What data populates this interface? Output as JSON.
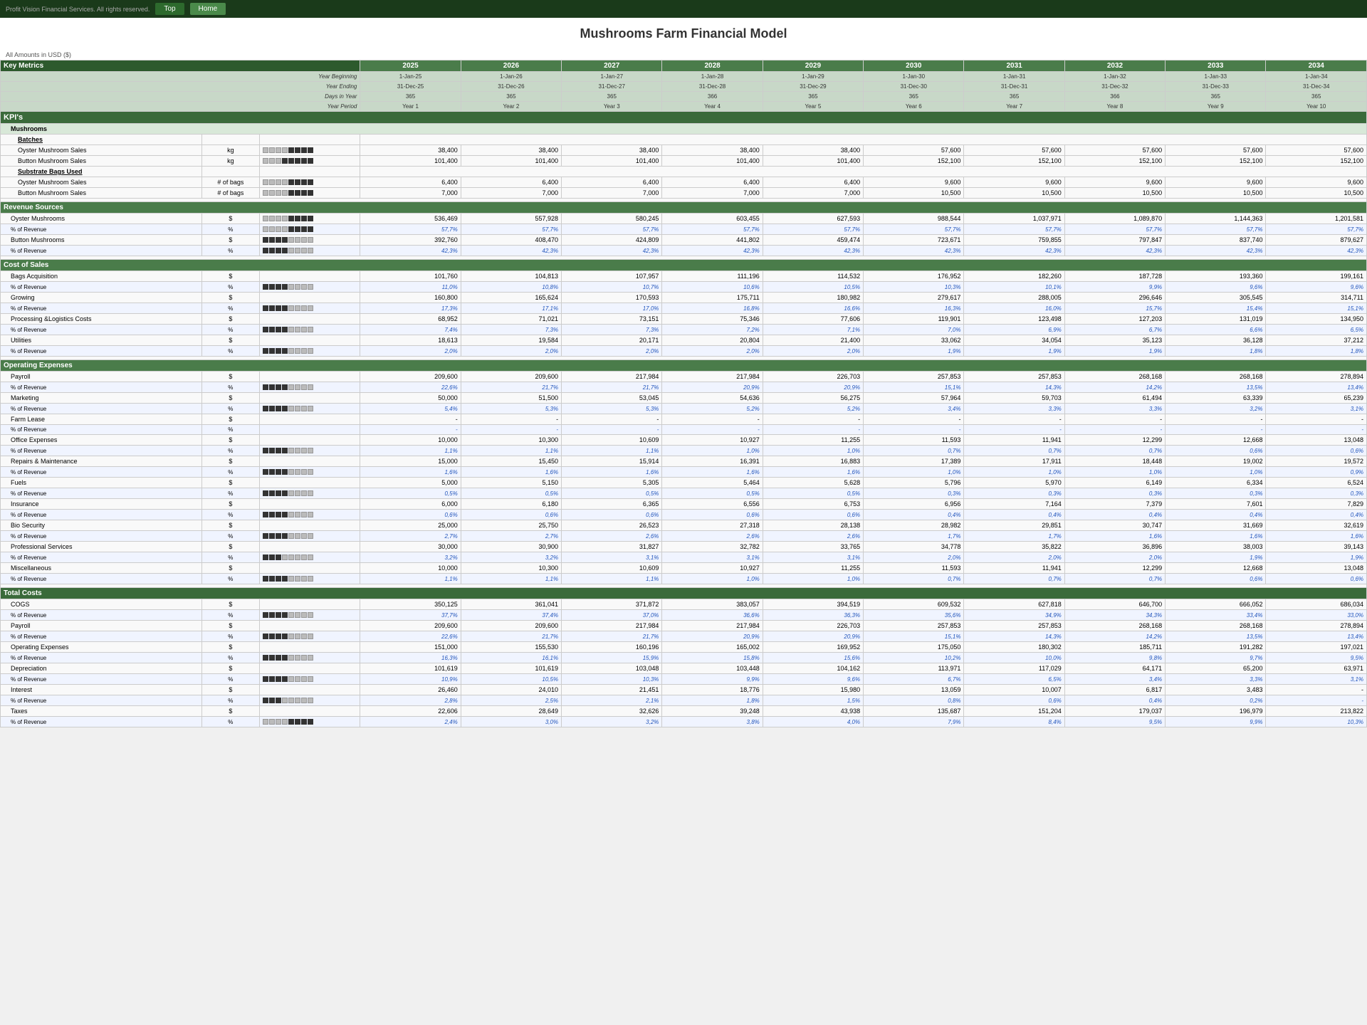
{
  "app": {
    "brand": "Profit Vision Financial Services. All rights reserved.",
    "title": "Mushrooms Farm Financial Model",
    "amounts_label": "All Amounts in USD ($)",
    "buttons": {
      "top": "Top",
      "home": "Home"
    }
  },
  "header": {
    "key_metrics": "Key Metrics",
    "years": [
      "2025",
      "2026",
      "2027",
      "2028",
      "2029",
      "2030",
      "2031",
      "2032",
      "2033",
      "2034"
    ],
    "year_beginning": [
      "1-Jan-25",
      "1-Jan-26",
      "1-Jan-27",
      "1-Jan-28",
      "1-Jan-29",
      "1-Jan-30",
      "1-Jan-31",
      "1-Jan-32",
      "1-Jan-33",
      "1-Jan-34"
    ],
    "year_ending": [
      "31-Dec-25",
      "31-Dec-26",
      "31-Dec-27",
      "31-Dec-28",
      "31-Dec-29",
      "31-Dec-30",
      "31-Dec-31",
      "31-Dec-32",
      "31-Dec-33",
      "31-Dec-34"
    ],
    "days_in_year": [
      "365",
      "365",
      "365",
      "366",
      "365",
      "365",
      "365",
      "366",
      "365",
      "365"
    ],
    "year_period": [
      "Year 1",
      "Year 2",
      "Year 3",
      "Year 4",
      "Year 5",
      "Year 6",
      "Year 7",
      "Year 8",
      "Year 9",
      "Year 10"
    ]
  },
  "sections": {
    "kpis": "KPI's",
    "mushrooms": "Mushrooms",
    "batches": "Batches",
    "substrate_bags_used": "Substrate Bags Used",
    "revenue_sources": "Revenue Sources",
    "cost_of_sales": "Cost of Sales",
    "operating_expenses": "Operating Expenses",
    "total_costs": "Total Costs"
  },
  "rows": {
    "oyster_mushroom_sales_kg": {
      "label": "Oyster Mushroom Sales",
      "unit": "kg",
      "vals": [
        "38,400",
        "38,400",
        "38,400",
        "38,400",
        "38,400",
        "57,600",
        "57,600",
        "57,600",
        "57,600",
        "57,600"
      ]
    },
    "button_mushroom_sales_kg": {
      "label": "Button Mushroom Sales",
      "unit": "kg",
      "vals": [
        "101,400",
        "101,400",
        "101,400",
        "101,400",
        "101,400",
        "152,100",
        "152,100",
        "152,100",
        "152,100",
        "152,100"
      ]
    },
    "oyster_bags": {
      "label": "Oyster Mushroom Sales",
      "unit": "# of bags",
      "vals": [
        "6,400",
        "6,400",
        "6,400",
        "6,400",
        "6,400",
        "9,600",
        "9,600",
        "9,600",
        "9,600",
        "9,600"
      ]
    },
    "button_bags": {
      "label": "Button Mushroom Sales",
      "unit": "# of bags",
      "vals": [
        "7,000",
        "7,000",
        "7,000",
        "7,000",
        "7,000",
        "10,500",
        "10,500",
        "10,500",
        "10,500",
        "10,500"
      ]
    },
    "oyster_revenue": {
      "label": "Oyster Mushrooms",
      "unit": "$",
      "vals": [
        "536,469",
        "557,928",
        "580,245",
        "603,455",
        "627,593",
        "988,544",
        "1,037,971",
        "1,089,870",
        "1,144,363",
        "1,201,581"
      ]
    },
    "oyster_pct": {
      "label": "% of Revenue",
      "unit": "%",
      "vals": [
        "57,7%",
        "57,7%",
        "57,7%",
        "57,7%",
        "57,7%",
        "57,7%",
        "57,7%",
        "57,7%",
        "57,7%",
        "57,7%"
      ]
    },
    "button_revenue": {
      "label": "Button Mushrooms",
      "unit": "$",
      "vals": [
        "392,760",
        "408,470",
        "424,809",
        "441,802",
        "459,474",
        "723,671",
        "759,855",
        "797,847",
        "837,740",
        "879,627"
      ]
    },
    "button_pct": {
      "label": "% of Revenue",
      "unit": "%",
      "vals": [
        "42,3%",
        "42,3%",
        "42,3%",
        "42,3%",
        "42,3%",
        "42,3%",
        "42,3%",
        "42,3%",
        "42,3%",
        "42,3%"
      ]
    },
    "bags_acq": {
      "label": "Bags Acquisition",
      "unit": "$",
      "vals": [
        "101,760",
        "104,813",
        "107,957",
        "111,196",
        "114,532",
        "176,952",
        "182,260",
        "187,728",
        "193,360",
        "199,161"
      ]
    },
    "bags_acq_pct": {
      "label": "% of Revenue",
      "unit": "%",
      "vals": [
        "11,0%",
        "10,8%",
        "10,7%",
        "10,6%",
        "10,5%",
        "10,3%",
        "10,1%",
        "9,9%",
        "9,6%",
        "9,6%"
      ]
    },
    "growing": {
      "label": "Growing",
      "unit": "$",
      "vals": [
        "160,800",
        "165,624",
        "170,593",
        "175,711",
        "180,982",
        "279,617",
        "288,005",
        "296,646",
        "305,545",
        "314,711"
      ]
    },
    "growing_pct": {
      "label": "% of Revenue",
      "unit": "%",
      "vals": [
        "17,3%",
        "17,1%",
        "17,0%",
        "16,8%",
        "16,6%",
        "16,3%",
        "16,0%",
        "15,7%",
        "15,4%",
        "15,1%"
      ]
    },
    "processing": {
      "label": "Processing &Logistics Costs",
      "unit": "$",
      "vals": [
        "68,952",
        "71,021",
        "73,151",
        "75,346",
        "77,606",
        "119,901",
        "123,498",
        "127,203",
        "131,019",
        "134,950"
      ]
    },
    "processing_pct": {
      "label": "% of Revenue",
      "unit": "%",
      "vals": [
        "7,4%",
        "7,3%",
        "7,3%",
        "7,2%",
        "7,1%",
        "7,0%",
        "6,9%",
        "6,7%",
        "6,6%",
        "6,5%"
      ]
    },
    "utilities": {
      "label": "Utilities",
      "unit": "$",
      "vals": [
        "18,613",
        "19,584",
        "20,171",
        "20,804",
        "21,400",
        "33,062",
        "34,054",
        "35,123",
        "36,128",
        "37,212"
      ]
    },
    "utilities_pct": {
      "label": "% of Revenue",
      "unit": "%",
      "vals": [
        "2,0%",
        "2,0%",
        "2,0%",
        "2,0%",
        "2,0%",
        "1,9%",
        "1,9%",
        "1,9%",
        "1,8%",
        "1,8%"
      ]
    },
    "payroll": {
      "label": "Payroll",
      "unit": "$",
      "vals": [
        "209,600",
        "209,600",
        "217,984",
        "217,984",
        "226,703",
        "257,853",
        "257,853",
        "268,168",
        "268,168",
        "278,894"
      ]
    },
    "payroll_pct": {
      "label": "% of Revenue",
      "unit": "%",
      "vals": [
        "22,6%",
        "21,7%",
        "21,7%",
        "20,9%",
        "20,9%",
        "15,1%",
        "14,3%",
        "14,2%",
        "13,5%",
        "13,4%"
      ]
    },
    "marketing": {
      "label": "Marketing",
      "unit": "$",
      "vals": [
        "50,000",
        "51,500",
        "53,045",
        "54,636",
        "56,275",
        "57,964",
        "59,703",
        "61,494",
        "63,339",
        "65,239"
      ]
    },
    "marketing_pct": {
      "label": "% of Revenue",
      "unit": "%",
      "vals": [
        "5,4%",
        "5,3%",
        "5,3%",
        "5,2%",
        "5,2%",
        "3,4%",
        "3,3%",
        "3,3%",
        "3,2%",
        "3,1%"
      ]
    },
    "farm_lease": {
      "label": "Farm Lease",
      "unit": "$",
      "vals": [
        "-",
        "-",
        "-",
        "-",
        "-",
        "-",
        "-",
        "-",
        "-",
        "-"
      ]
    },
    "farm_lease_pct": {
      "label": "% of Revenue",
      "unit": "%",
      "vals": [
        "-",
        "-",
        "-",
        "-",
        "-",
        "-",
        "-",
        "-",
        "-",
        "-"
      ]
    },
    "office_expenses": {
      "label": "Office Expenses",
      "unit": "$",
      "vals": [
        "10,000",
        "10,300",
        "10,609",
        "10,927",
        "11,255",
        "11,593",
        "11,941",
        "12,299",
        "12,668",
        "13,048"
      ]
    },
    "office_expenses_pct": {
      "label": "% of Revenue",
      "unit": "%",
      "vals": [
        "1,1%",
        "1,1%",
        "1,1%",
        "1,0%",
        "1,0%",
        "0,7%",
        "0,7%",
        "0,7%",
        "0,6%",
        "0,6%"
      ]
    },
    "repairs": {
      "label": "Repairs & Maintenance",
      "unit": "$",
      "vals": [
        "15,000",
        "15,450",
        "15,914",
        "16,391",
        "16,883",
        "17,389",
        "17,911",
        "18,448",
        "19,002",
        "19,572"
      ]
    },
    "repairs_pct": {
      "label": "% of Revenue",
      "unit": "%",
      "vals": [
        "1,6%",
        "1,6%",
        "1,6%",
        "1,6%",
        "1,6%",
        "1,0%",
        "1,0%",
        "1,0%",
        "1,0%",
        "0,9%"
      ]
    },
    "fuels": {
      "label": "Fuels",
      "unit": "$",
      "vals": [
        "5,000",
        "5,150",
        "5,305",
        "5,464",
        "5,628",
        "5,796",
        "5,970",
        "6,149",
        "6,334",
        "6,524"
      ]
    },
    "fuels_pct": {
      "label": "% of Revenue",
      "unit": "%",
      "vals": [
        "0,5%",
        "0,5%",
        "0,5%",
        "0,5%",
        "0,5%",
        "0,3%",
        "0,3%",
        "0,3%",
        "0,3%",
        "0,3%"
      ]
    },
    "insurance": {
      "label": "Insurance",
      "unit": "$",
      "vals": [
        "6,000",
        "6,180",
        "6,365",
        "6,556",
        "6,753",
        "6,956",
        "7,164",
        "7,379",
        "7,601",
        "7,829"
      ]
    },
    "insurance_pct": {
      "label": "% of Revenue",
      "unit": "%",
      "vals": [
        "0,6%",
        "0,6%",
        "0,6%",
        "0,6%",
        "0,6%",
        "0,4%",
        "0,4%",
        "0,4%",
        "0,4%",
        "0,4%"
      ]
    },
    "bio_security": {
      "label": "Bio Security",
      "unit": "$",
      "vals": [
        "25,000",
        "25,750",
        "26,523",
        "27,318",
        "28,138",
        "28,982",
        "29,851",
        "30,747",
        "31,669",
        "32,619"
      ]
    },
    "bio_security_pct": {
      "label": "% of Revenue",
      "unit": "%",
      "vals": [
        "2,7%",
        "2,7%",
        "2,6%",
        "2,6%",
        "2,6%",
        "1,7%",
        "1,7%",
        "1,6%",
        "1,6%",
        "1,6%"
      ]
    },
    "prof_services": {
      "label": "Professional Services",
      "unit": "$",
      "vals": [
        "30,000",
        "30,900",
        "31,827",
        "32,782",
        "33,765",
        "34,778",
        "35,822",
        "36,896",
        "38,003",
        "39,143"
      ]
    },
    "prof_services_pct": {
      "label": "% of Revenue",
      "unit": "%",
      "vals": [
        "3,2%",
        "3,2%",
        "3,1%",
        "3,1%",
        "3,1%",
        "2,0%",
        "2,0%",
        "2,0%",
        "1,9%",
        "1,9%"
      ]
    },
    "miscellaneous": {
      "label": "Miscellaneous",
      "unit": "$",
      "vals": [
        "10,000",
        "10,300",
        "10,609",
        "10,927",
        "11,255",
        "11,593",
        "11,941",
        "12,299",
        "12,668",
        "13,048"
      ]
    },
    "miscellaneous_pct": {
      "label": "% of Revenue",
      "unit": "%",
      "vals": [
        "1,1%",
        "1,1%",
        "1,1%",
        "1,0%",
        "1,0%",
        "0,7%",
        "0,7%",
        "0,7%",
        "0,6%",
        "0,6%"
      ]
    },
    "cogs": {
      "label": "COGS",
      "unit": "$",
      "vals": [
        "350,125",
        "361,041",
        "371,872",
        "383,057",
        "394,519",
        "609,532",
        "627,818",
        "646,700",
        "666,052",
        "686,034"
      ]
    },
    "cogs_pct": {
      "label": "% of Revenue",
      "unit": "%",
      "vals": [
        "37,7%",
        "37,4%",
        "37,0%",
        "36,6%",
        "36,3%",
        "35,6%",
        "34,9%",
        "34,3%",
        "33,4%",
        "33,0%"
      ]
    },
    "tc_payroll": {
      "label": "Payroll",
      "unit": "$",
      "vals": [
        "209,600",
        "209,600",
        "217,984",
        "217,984",
        "226,703",
        "257,853",
        "257,853",
        "268,168",
        "268,168",
        "278,894"
      ]
    },
    "tc_payroll_pct": {
      "label": "% of Revenue",
      "unit": "%",
      "vals": [
        "22,6%",
        "21,7%",
        "21,7%",
        "20,9%",
        "20,9%",
        "15,1%",
        "14,3%",
        "14,2%",
        "13,5%",
        "13,4%"
      ]
    },
    "tc_op_exp": {
      "label": "Operating Expenses",
      "unit": "$",
      "vals": [
        "151,000",
        "155,530",
        "160,196",
        "165,002",
        "169,952",
        "175,050",
        "180,302",
        "185,711",
        "191,282",
        "197,021"
      ]
    },
    "tc_op_exp_pct": {
      "label": "% of Revenue",
      "unit": "%",
      "vals": [
        "16,3%",
        "16,1%",
        "15,9%",
        "15,8%",
        "15,6%",
        "10,2%",
        "10,0%",
        "9,8%",
        "9,7%",
        "9,5%"
      ]
    },
    "depreciation": {
      "label": "Depreciation",
      "unit": "$",
      "vals": [
        "101,619",
        "101,619",
        "103,048",
        "103,448",
        "104,162",
        "113,971",
        "117,029",
        "64,171",
        "65,200",
        "63,971"
      ]
    },
    "depreciation_pct": {
      "label": "% of Revenue",
      "unit": "%",
      "vals": [
        "10,9%",
        "10,5%",
        "10,3%",
        "9,9%",
        "9,6%",
        "6,7%",
        "6,5%",
        "3,4%",
        "3,3%",
        "3,1%"
      ]
    },
    "interest": {
      "label": "Interest",
      "unit": "$",
      "vals": [
        "26,460",
        "24,010",
        "21,451",
        "18,776",
        "15,980",
        "13,059",
        "10,007",
        "6,817",
        "3,483",
        "-"
      ]
    },
    "interest_pct": {
      "label": "% of Revenue",
      "unit": "%",
      "vals": [
        "2,8%",
        "2,5%",
        "2,1%",
        "1,8%",
        "1,5%",
        "0,8%",
        "0,6%",
        "0,4%",
        "0,2%",
        "-"
      ]
    },
    "taxes": {
      "label": "Taxes",
      "unit": "$",
      "vals": [
        "22,606",
        "28,649",
        "32,626",
        "39,248",
        "43,938",
        "135,687",
        "151,204",
        "179,037",
        "196,979",
        "213,822"
      ]
    },
    "taxes_pct": {
      "label": "% of Revenue",
      "unit": "%",
      "vals": [
        "2,4%",
        "3,0%",
        "3,2%",
        "3,8%",
        "4,0%",
        "7,9%",
        "8,4%",
        "9,5%",
        "9,9%",
        "10,3%"
      ]
    }
  }
}
